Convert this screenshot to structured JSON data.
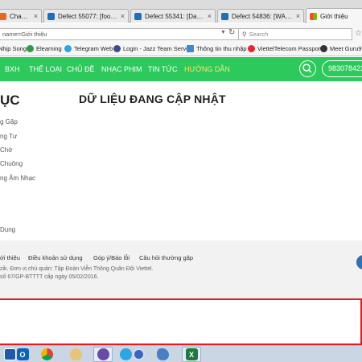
{
  "browser": {
    "tabs": [
      {
        "label": "Change ...",
        "icon": "firefox-tab-icon",
        "color": "#e86a1f"
      },
      {
        "label": "Defect 55077: [footer ...",
        "icon": "defect-tab-icon",
        "color": "#1f6fb8"
      },
      {
        "label": "Defect 55341: [Danh s...",
        "icon": "defect-tab-icon",
        "color": "#1f6fb8"
      },
      {
        "label": "Defect 54836: [WAP][T...",
        "icon": "defect-tab-icon",
        "color": "#1f6fb8"
      },
      {
        "label": "Giới thiệu",
        "icon": "windows-tab-icon",
        "color": "#f25022",
        "active": true
      }
    ],
    "url": "name=Giới thiệu",
    "search_placeholder": "Search",
    "bookmarks": [
      {
        "label": "Nhịp Song",
        "icon": "nhipsong-icon",
        "color": "#3aa0d8"
      },
      {
        "label": "Elearning",
        "icon": "elearning-icon",
        "color": "#2e9a45"
      },
      {
        "label": "Telegram Web",
        "icon": "telegram-icon",
        "color": "#2ca5e0"
      },
      {
        "label": "Login - Jazz Team Server",
        "icon": "jazz-icon",
        "color": "#3d4c8c"
      },
      {
        "label": "Thông tin thu nhập",
        "icon": "grid-icon",
        "color": "#3a8ad8"
      },
      {
        "label": "ViettelTelecom Passport",
        "icon": "viettel-icon",
        "color": "#e8252b"
      },
      {
        "label": "Meet Guru99",
        "icon": "guru99-icon",
        "color": "#333333"
      }
    ]
  },
  "site": {
    "menu": [
      {
        "label": "BXH"
      },
      {
        "label": "THỂ LOẠI"
      },
      {
        "label": "CHỦ ĐỀ"
      },
      {
        "label": "NHẠC PHIM"
      },
      {
        "label": "TIN TỨC"
      },
      {
        "label": "HƯỚNG DẪN",
        "active": true
      }
    ],
    "phone": "983078423",
    "nav_color": "#2ec95c",
    "active_color": "#ffe46b"
  },
  "content": {
    "sidebar_title": "ỤC",
    "main_title": "DỮ LIỆU ĐANG CẬP NHẬT",
    "sidebar_items": [
      "g Gặp",
      "ng Tư",
      "Chờ",
      "Chuông",
      "ng Âm Nhạc",
      "Dụng"
    ]
  },
  "footer": {
    "links": [
      "ới thiệu",
      "Điều khoản sử dụng",
      "Góp ý/Báo lỗi",
      "Câu hỏi thường gặp"
    ],
    "lines": [
      "zik. Đơn vị chủ quản: Tập Đoàn Viễn Thông Quân Đội Viettel.",
      "số 67/GP-BTTTT cấp ngày 05/02/2016."
    ]
  },
  "taskbar": {
    "icons": [
      {
        "name": "app-icon",
        "color": "#1e5aa8",
        "glyph": ""
      },
      {
        "name": "outlook-icon",
        "color": "#0a64b8",
        "glyph": "O"
      },
      {
        "name": "chrome-icon",
        "color": "#dd4b39",
        "glyph": ""
      },
      {
        "name": "paint-icon",
        "color": "#c9a24a",
        "glyph": ""
      },
      {
        "name": "firefox-icon",
        "color": "#6a4aa8",
        "glyph": ""
      },
      {
        "name": "telegram-icon",
        "color": "#2ca5e0",
        "glyph": ""
      },
      {
        "name": "helper-icon",
        "color": "#3e62c0",
        "glyph": ""
      },
      {
        "name": "dolphin-icon",
        "color": "#4a7fc8",
        "glyph": ""
      },
      {
        "name": "excel-icon",
        "color": "#1f7a3f",
        "glyph": "X"
      }
    ]
  }
}
